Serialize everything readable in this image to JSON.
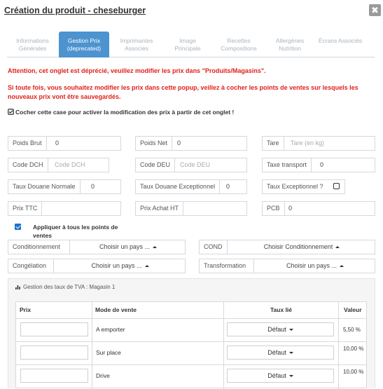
{
  "window": {
    "title": "Création du produit - cheseburger",
    "close_label": "✖"
  },
  "tabs": [
    {
      "label": "Informations Générales",
      "active": false
    },
    {
      "label": "Gestion Prix (deprecated)",
      "active": true
    },
    {
      "label": "Imprimantes Associés",
      "active": false
    },
    {
      "label": "Image Principale",
      "active": false
    },
    {
      "label": "Recettes Compositions",
      "active": false
    },
    {
      "label": "Allergènes Nutrition",
      "active": false
    },
    {
      "label": "Écrans Associés",
      "active": false
    }
  ],
  "warnings": {
    "line1": "Attention, cet onglet est déprécié, veuillez modifier les prix dans \"Produits/Magasins\".",
    "line2": "Si toute fois, vous souhaitez modifier les prix dans cette popup, veillez à cocher les points de ventes sur lesquels les nouveaux prix vont être sauvegardés."
  },
  "activate_checkbox": {
    "label": "Cocher cette case pour activer la modification des prix à partir de cet onglet !",
    "checked": true
  },
  "fields": {
    "poids_brut": {
      "label": "Poids Brut",
      "value": "0"
    },
    "poids_net": {
      "label": "Poids Net",
      "value": "0"
    },
    "tare": {
      "label": "Tare",
      "placeholder": "Tare (en kg)"
    },
    "code_dch": {
      "label": "Code DCH",
      "placeholder": "Code DCH"
    },
    "code_deu": {
      "label": "Code DEU",
      "placeholder": "Code DEU"
    },
    "taxe_transport": {
      "label": "Taxe transport",
      "value": "0"
    },
    "taux_douane_normale": {
      "label": "Taux Douane Normale",
      "value": "0"
    },
    "taux_douane_exceptionnel": {
      "label": "Taux Douane Exceptionnel",
      "value": "0"
    },
    "taux_exceptionnel": {
      "label": "Taux Exceptionnel ?",
      "checked": false
    },
    "prix_ttc": {
      "label": "Prix TTC",
      "value": ""
    },
    "prix_achat_ht": {
      "label": "Prix Achat HT",
      "value": ""
    },
    "pcb": {
      "label": "PCB",
      "value": "0"
    }
  },
  "apply_all": {
    "label": "Appliquer à tous les points de ventes",
    "checked": true
  },
  "selects": {
    "conditionnement": {
      "label": "Conditionnement",
      "value": "Choisir un pays ..."
    },
    "cond": {
      "label": "COND",
      "value": "Choisir Conditionnement"
    },
    "congelation": {
      "label": "Congélation",
      "value": "Choisir un pays ..."
    },
    "transformation": {
      "label": "Transformation",
      "value": "Choisir un pays ..."
    }
  },
  "tva_panel": {
    "title": "Gestion des taux de TVA : Magasin 1",
    "headers": {
      "prix": "Prix",
      "mode": "Mode de vente",
      "taux": "Taux lié",
      "valeur": "Valeur"
    },
    "rows": [
      {
        "mode": "A emporter",
        "taux": "Défaut",
        "valeur": "5,50 %"
      },
      {
        "mode": "Sur place",
        "taux": "Défaut",
        "valeur": "10,00 %"
      },
      {
        "mode": "Drive",
        "taux": "Défaut",
        "valeur": "10,00 %"
      }
    ]
  },
  "colors": {
    "accent": "#4d93cf",
    "warning": "#e0211b",
    "checkbox": "#1e73c9"
  },
  "icons": {
    "close": "close-icon",
    "check": "check-square-icon",
    "chart": "bar-chart-icon",
    "caret_up": "caret-up-icon",
    "caret_down": "caret-down-icon"
  }
}
